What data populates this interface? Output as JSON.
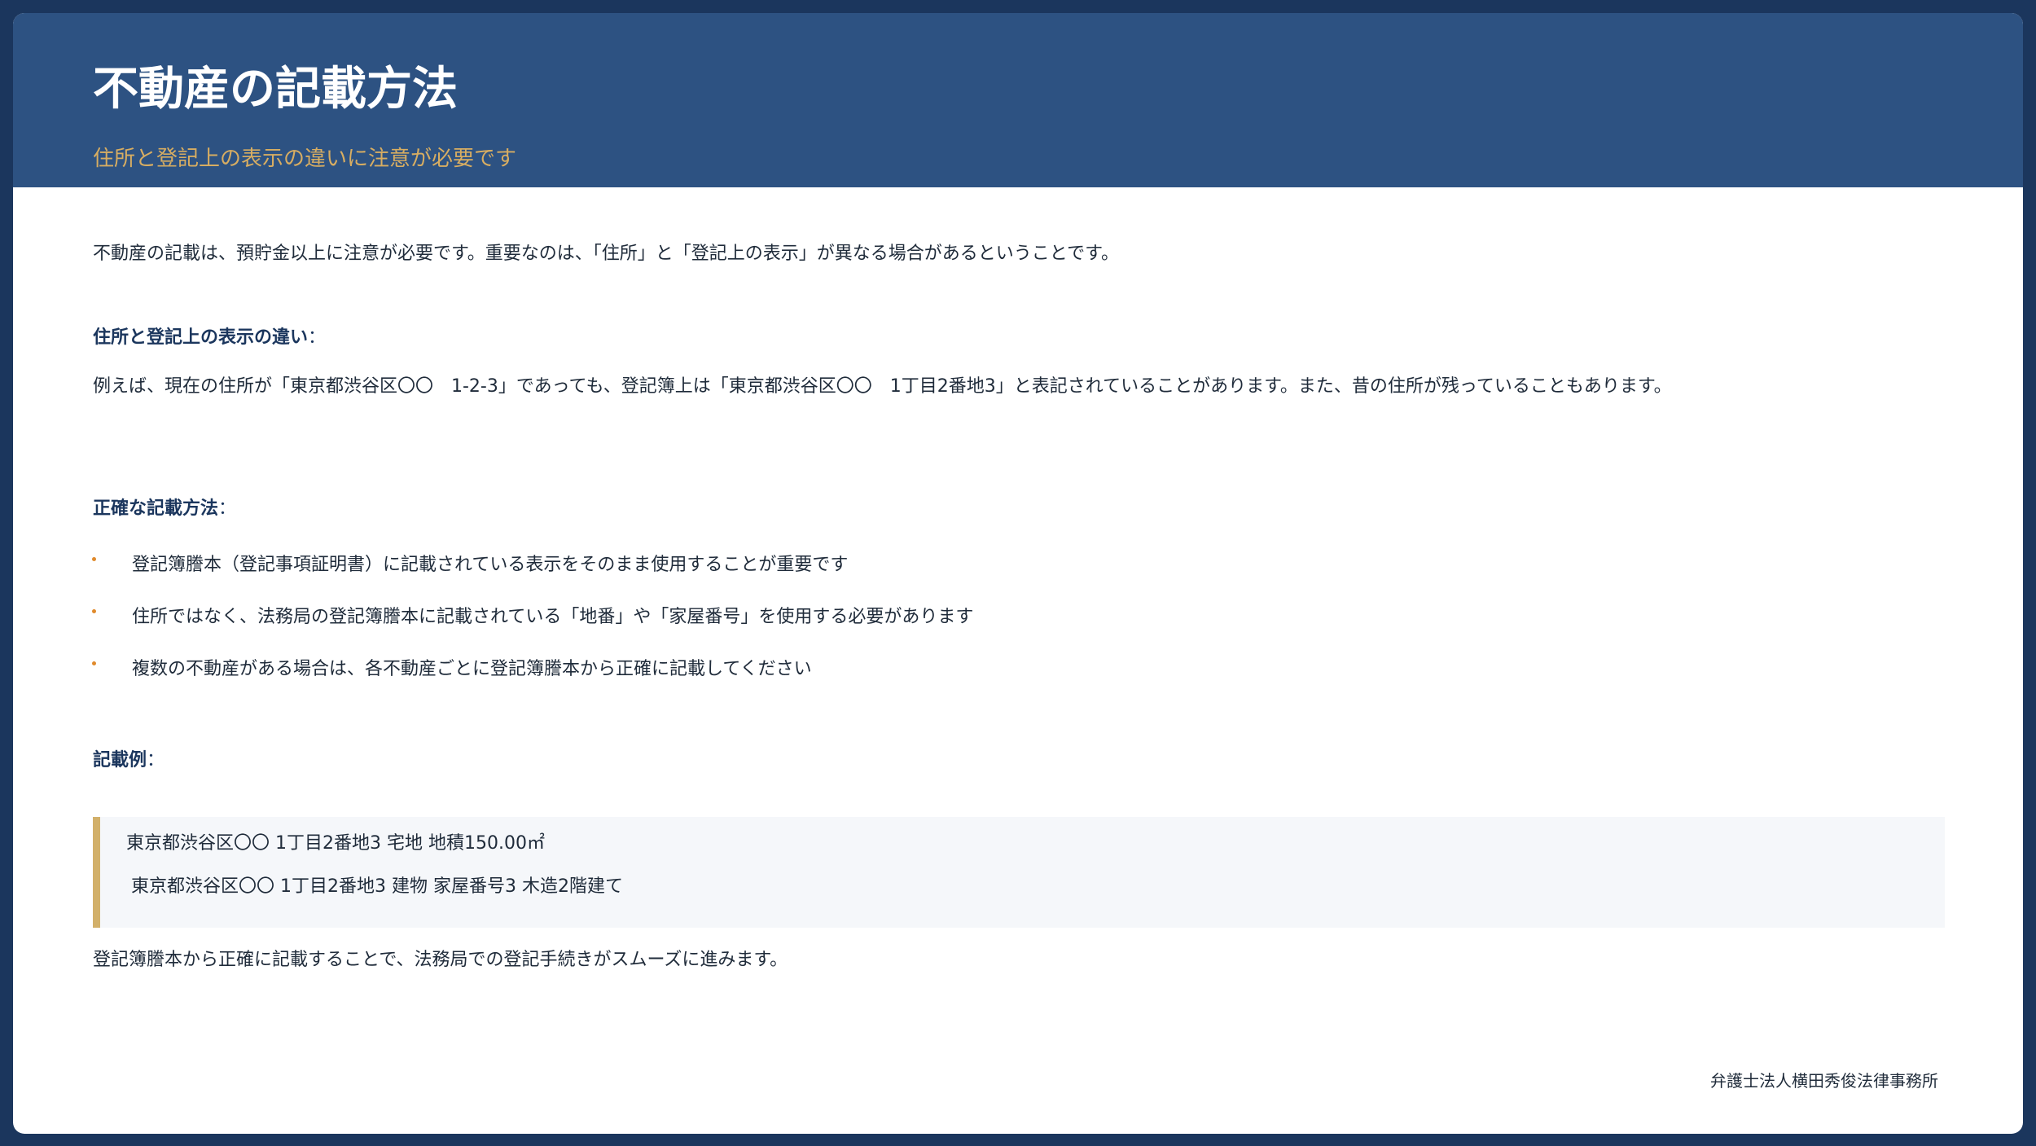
{
  "header": {
    "title": "不動産の記載方法",
    "subtitle": "住所と登記上の表示の違いに注意が必要です"
  },
  "intro": "不動産の記載は、預貯金以上に注意が必要です。重要なのは、「住所」と「登記上の表示」が異なる場合があるということです。",
  "difference": {
    "heading": "住所と登記上の表示の違い",
    "colon": "：",
    "body": "例えば、現在の住所が「東京都渋谷区〇〇　1-2-3」であっても、登記簿上は「東京都渋谷区〇〇　1丁目2番地3」と表記されていることがあります。また、昔の住所が残っていることもあります。"
  },
  "method": {
    "heading": "正確な記載方法",
    "colon": "：",
    "bullets": [
      "登記簿謄本（登記事項証明書）に記載されている表示をそのまま使用することが重要です",
      "住所ではなく、法務局の登記簿謄本に記載されている「地番」や「家屋番号」を使用する必要があります",
      "複数の不動産がある場合は、各不動産ごとに登記簿謄本から正確に記載してください"
    ]
  },
  "example": {
    "heading": "記載例",
    "colon": "：",
    "lines": [
      "東京都渋谷区〇〇 1丁目2番地3 宅地 地積150.00㎡",
      "東京都渋谷区〇〇 1丁目2番地3 建物 家屋番号3 木造2階建て"
    ]
  },
  "closing": "登記簿謄本から正確に記載することで、法務局での登記手続きがスムーズに進みます。",
  "footer": "弁護士法人横田秀俊法律事務所",
  "colors": {
    "frame": "#1b365d",
    "header": "#2d5282",
    "accent": "#d7ad62",
    "bullet": "#e08a2c"
  }
}
